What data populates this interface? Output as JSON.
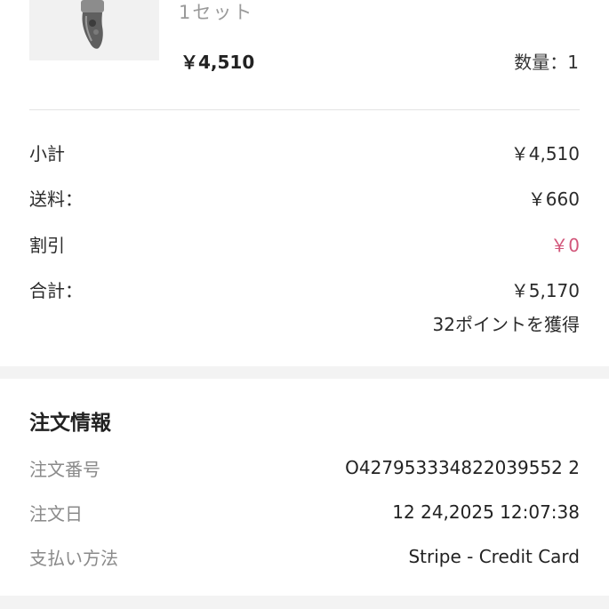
{
  "product": {
    "variant": "1セット",
    "price": "￥4,510",
    "quantity": "数量：1",
    "thumbnail_icon": "ring-product-image"
  },
  "summary": {
    "subtotal_label": "小計",
    "subtotal_value": "￥4,510",
    "shipping_label": "送料：",
    "shipping_value": "￥660",
    "discount_label": "割引",
    "discount_value": "￥0",
    "total_label": "合計：",
    "total_value": "￥5,170",
    "points_text": "32ポイントを獲得",
    "discount_color": "#d2577b"
  },
  "order_info": {
    "title": "注文情報",
    "order_no_label": "注文番号",
    "order_no_value": "O427953334822039552 2",
    "order_date_label": "注文日",
    "order_date_value": "12 24,2025 12:07:38",
    "payment_label": "支払い方法",
    "payment_value": "Stripe - Credit Card"
  }
}
